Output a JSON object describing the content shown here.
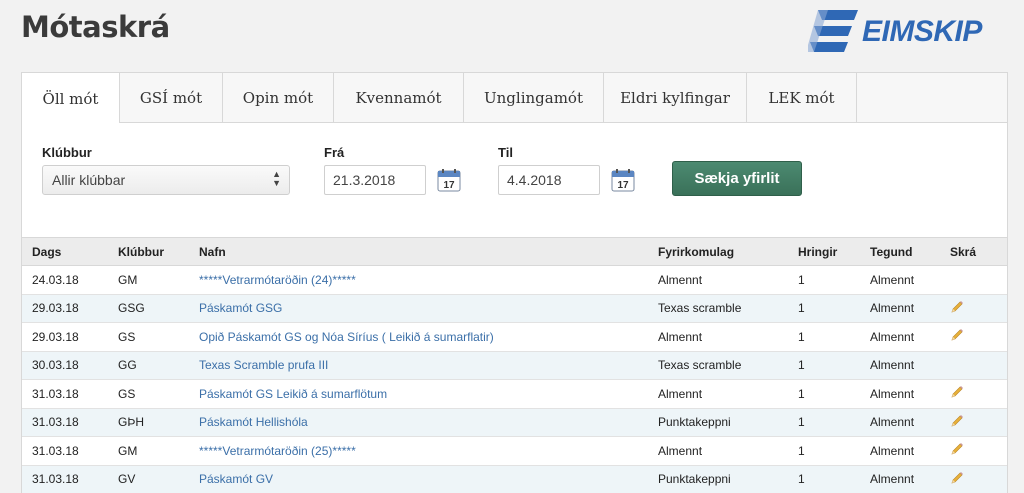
{
  "header": {
    "title": "Mótaskrá",
    "logo_text": "EIMSKIP"
  },
  "tabs": [
    "Öll mót",
    "GSÍ mót",
    "Opin mót",
    "Kvennamót",
    "Unglingamót",
    "Eldri kylfingar",
    "LEK mót"
  ],
  "active_tab": 0,
  "filters": {
    "club_label": "Klúbbur",
    "club_value": "Allir klúbbar",
    "from_label": "Frá",
    "from_value": "21.3.2018",
    "to_label": "Til",
    "to_value": "4.4.2018",
    "calendar_day": "17",
    "submit_label": "Sækja yfirlit"
  },
  "table": {
    "columns": [
      "Dags",
      "Klúbbur",
      "Nafn",
      "Fyrirkomulag",
      "Hringir",
      "Tegund",
      "Skrá"
    ],
    "rows": [
      {
        "date": "24.03.18",
        "club": "GM",
        "name": "*****Vetrarmótaröðin (24)*****",
        "format": "Almennt",
        "rounds": "1",
        "type": "Almennt",
        "register": false
      },
      {
        "date": "29.03.18",
        "club": "GSG",
        "name": "Páskamót GSG",
        "format": "Texas scramble",
        "rounds": "1",
        "type": "Almennt",
        "register": true
      },
      {
        "date": "29.03.18",
        "club": "GS",
        "name": "Opið Páskamót GS og Nóa Síríus ( Leikið á sumarflatir)",
        "format": "Almennt",
        "rounds": "1",
        "type": "Almennt",
        "register": true
      },
      {
        "date": "30.03.18",
        "club": "GG",
        "name": "Texas Scramble prufa III",
        "format": "Texas scramble",
        "rounds": "1",
        "type": "Almennt",
        "register": false
      },
      {
        "date": "31.03.18",
        "club": "GS",
        "name": "Páskamót GS Leikið á sumarflötum",
        "format": "Almennt",
        "rounds": "1",
        "type": "Almennt",
        "register": true
      },
      {
        "date": "31.03.18",
        "club": "GÞH",
        "name": "Páskamót Hellishóla",
        "format": "Punktakeppni",
        "rounds": "1",
        "type": "Almennt",
        "register": true
      },
      {
        "date": "31.03.18",
        "club": "GM",
        "name": "*****Vetrarmótaröðin (25)*****",
        "format": "Almennt",
        "rounds": "1",
        "type": "Almennt",
        "register": true
      },
      {
        "date": "31.03.18",
        "club": "GV",
        "name": "Páskamót GV",
        "format": "Punktakeppni",
        "rounds": "1",
        "type": "Almennt",
        "register": true
      }
    ]
  },
  "colors": {
    "link": "#3b6fa8",
    "button": "#3f7a60",
    "logo": "#2f68b5"
  }
}
